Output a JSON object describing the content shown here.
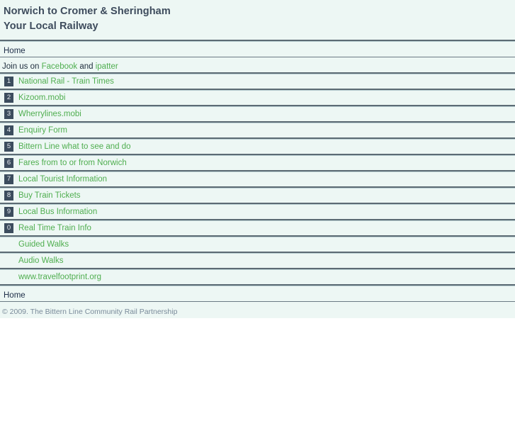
{
  "header": {
    "title_line1": "Norwich to Cromer & Sheringham",
    "title_line2": "Your Local Railway"
  },
  "breadcrumb": {
    "home_label": "Home"
  },
  "social": {
    "prefix": "Join us on ",
    "facebook_label": "Facebook",
    "conjunction": " and ",
    "ipatter_label": "ipatter"
  },
  "menu": {
    "items": [
      {
        "number": "1",
        "label": "National Rail - Train Times"
      },
      {
        "number": "2",
        "label": "Kizoom.mobi"
      },
      {
        "number": "3",
        "label": "Wherrylines.mobi"
      },
      {
        "number": "4",
        "label": "Enquiry Form"
      },
      {
        "number": "5",
        "label": "Bittern Line what to see and do"
      },
      {
        "number": "6",
        "label": "Fares from to or from Norwich"
      },
      {
        "number": "7",
        "label": "Local Tourist Information"
      },
      {
        "number": "8",
        "label": "Buy Train Tickets"
      },
      {
        "number": "9",
        "label": "Local Bus Information"
      },
      {
        "number": "0",
        "label": "Real Time Train Info"
      },
      {
        "number": "",
        "label": "Guided Walks"
      },
      {
        "number": "",
        "label": "Audio Walks"
      },
      {
        "number": "",
        "label": "www.travelfootprint.org"
      }
    ]
  },
  "footer": {
    "home_label": "Home",
    "copyright": "© 2009. The Bittern Line Community Rail Partnership"
  },
  "colors": {
    "background": "#edf7f4",
    "link_green": "#4fae4f",
    "heading_slate": "#3d4b5c",
    "badge_bg": "#3c4d5e",
    "rule": "#5c6b74"
  }
}
